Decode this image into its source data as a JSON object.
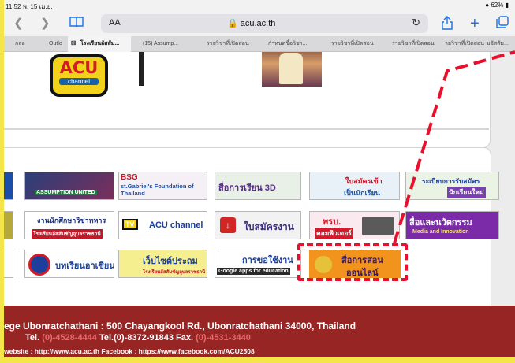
{
  "status": {
    "time": "11:52",
    "date": "พ. 15 เม.ย.",
    "battery": "62%"
  },
  "toolbar": {
    "back_icon": "chevron-left-icon",
    "forward_icon": "chevron-right-icon",
    "book_icon": "book-icon",
    "text_size_label": "AA",
    "url": "acu.ac.th",
    "lock_icon": "lock-icon",
    "reload_icon": "reload-icon",
    "share_icon": "share-icon",
    "new_tab_icon": "plus-icon",
    "tabs_icon": "tabs-icon"
  },
  "tabs": [
    "กล่อ",
    "Outlo",
    "โรงเรียนอัสสัม...",
    "(15) Assump...",
    "รายวิชาที่เปิดสอน",
    "กำหนดชื่อวิชา...",
    "รายวิชาที่เปิดสอน",
    "รายวิชาที่เปิดสอน",
    "ายวิชาที่เปิดสอน",
    "มอัสสัม..."
  ],
  "acu_logo": {
    "title": "ACU",
    "subtitle": "channel"
  },
  "banners": {
    "assumption": "ASSUMPTION UNITED",
    "bsg_title": "BSG",
    "bsg_sub": "st.Gabriel's Foundation of Thailand",
    "media_3d": "สื่อการเรียน 3D",
    "apply_top": "ใบสมัครเข้า",
    "apply_bottom": "เป็นนักเรียน",
    "rules_top": "ระเบียบการรับสมัคร",
    "rules_bottom": "นักเรียนใหม่",
    "academic_top": "งานนักศึกษาวิชาทหาร",
    "academic_bottom": "โรงเรียนอัสสัมชัญอุบลราชธานี",
    "acu_channel": "ACU channel",
    "job_form": "ใบสมัครงาน",
    "computer_top": "พรบ.",
    "computer_bottom": "คอมพิวเตอร์",
    "innovation_top": "สื่อและนวัตกรรม",
    "innovation_bottom": "Media and Innovation",
    "asean": "บทเรียนอาเซียน",
    "websites_top": "เว็บไซต์ประถม",
    "websites_bottom": "โรงเรียนอัสสัมชัญอุบลราชธานี",
    "google_top": "การขอใช้งาน",
    "google_bottom": "Google apps for education",
    "online_top": "สื่อการสอน",
    "online_bottom": "ออนไลน์"
  },
  "footer": {
    "address": "ege Ubonratchathani : 500 Chayangkool Rd., Ubonratchathani 34000, Thailand",
    "tel_label": "Tel.",
    "tel1": "(0)-4528-4444",
    "tel2": "Tel.(0)-8372-91843",
    "fax_label": "Fax.",
    "fax": "(0)-4531-3440",
    "web": "website : http://www.acu.ac.th Facebook : https://www.facebook.com/ACU2508"
  },
  "colors": {
    "footer": "#972524",
    "highlight": "#e8102d",
    "frame": "#f4e64a"
  }
}
